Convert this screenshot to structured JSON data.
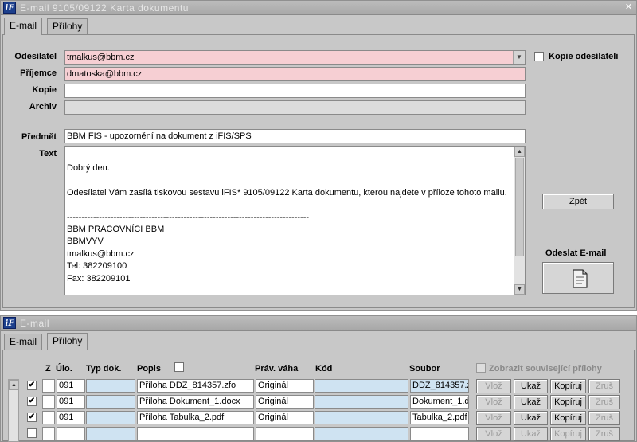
{
  "window1": {
    "title": "E-mail   9105/09122 Karta dokumentu",
    "tabs": [
      "E-mail",
      "Přílohy"
    ],
    "labels": {
      "sender": "Odesílatel",
      "recipient": "Příjemce",
      "copy": "Kopie",
      "archive": "Archiv",
      "subject": "Předmět",
      "text": "Text"
    },
    "values": {
      "sender": "tmalkus@bbm.cz",
      "recipient": "dmatoska@bbm.cz",
      "copy": "",
      "archive": "",
      "subject": "BBM FIS - upozornění na dokument z iFIS/SPS"
    },
    "copy_to_sender_label": "Kopie odesílateli",
    "body_lines": [
      "Dobrý den.",
      "",
      "Odesílatel Vám zasílá tiskovou sestavu iFIS* 9105/09122 Karta dokumentu, kterou najdete v příloze tohoto mailu.",
      "",
      "-----------------------------------------------------------------------------------",
      "BBM PRACOVNÍCI BBM",
      "BBMVYV",
      "tmalkus@bbm.cz",
      "Tel: 382209100",
      "Fax: 382209101",
      "",
      "-----------------------------------------------------------------------------------"
    ],
    "back_button": "Zpět",
    "send_label": "Odeslat E-mail"
  },
  "window2": {
    "title": "E-mail",
    "tabs": [
      "E-mail",
      "Přílohy"
    ],
    "columns": {
      "z": "Z",
      "ulo": "Úlo.",
      "typ": "Typ dok.",
      "popis": "Popis",
      "prav": "Práv. váha",
      "kod": "Kód",
      "soubor": "Soubor"
    },
    "show_related_label": "Zobrazit související přílohy",
    "row_buttons": {
      "vloz": "Vlož",
      "ukaz": "Ukaž",
      "kopiruj": "Kopíruj",
      "zrus": "Zruš"
    },
    "rows": [
      {
        "z": "✔",
        "ulo": "091",
        "typ": "",
        "popis": "Příloha DDZ_814357.zfo",
        "prav": "Originál",
        "kod": "",
        "soubor": "DDZ_814357.z"
      },
      {
        "z": "✔",
        "ulo": "091",
        "typ": "",
        "popis": "Příloha Dokument_1.docx",
        "prav": "Originál",
        "kod": "",
        "soubor": "Dokument_1.d"
      },
      {
        "z": "✔",
        "ulo": "091",
        "typ": "",
        "popis": "Příloha Tabulka_2.pdf",
        "prav": "Originál",
        "kod": "",
        "soubor": "Tabulka_2.pdf"
      },
      {
        "z": "",
        "ulo": "",
        "typ": "",
        "popis": "",
        "prav": "",
        "kod": "",
        "soubor": ""
      }
    ]
  },
  "colors": {
    "required_field": "#f6cfd3",
    "highlight_cell": "#cfe3f2",
    "logo": "#1c3f8c"
  }
}
